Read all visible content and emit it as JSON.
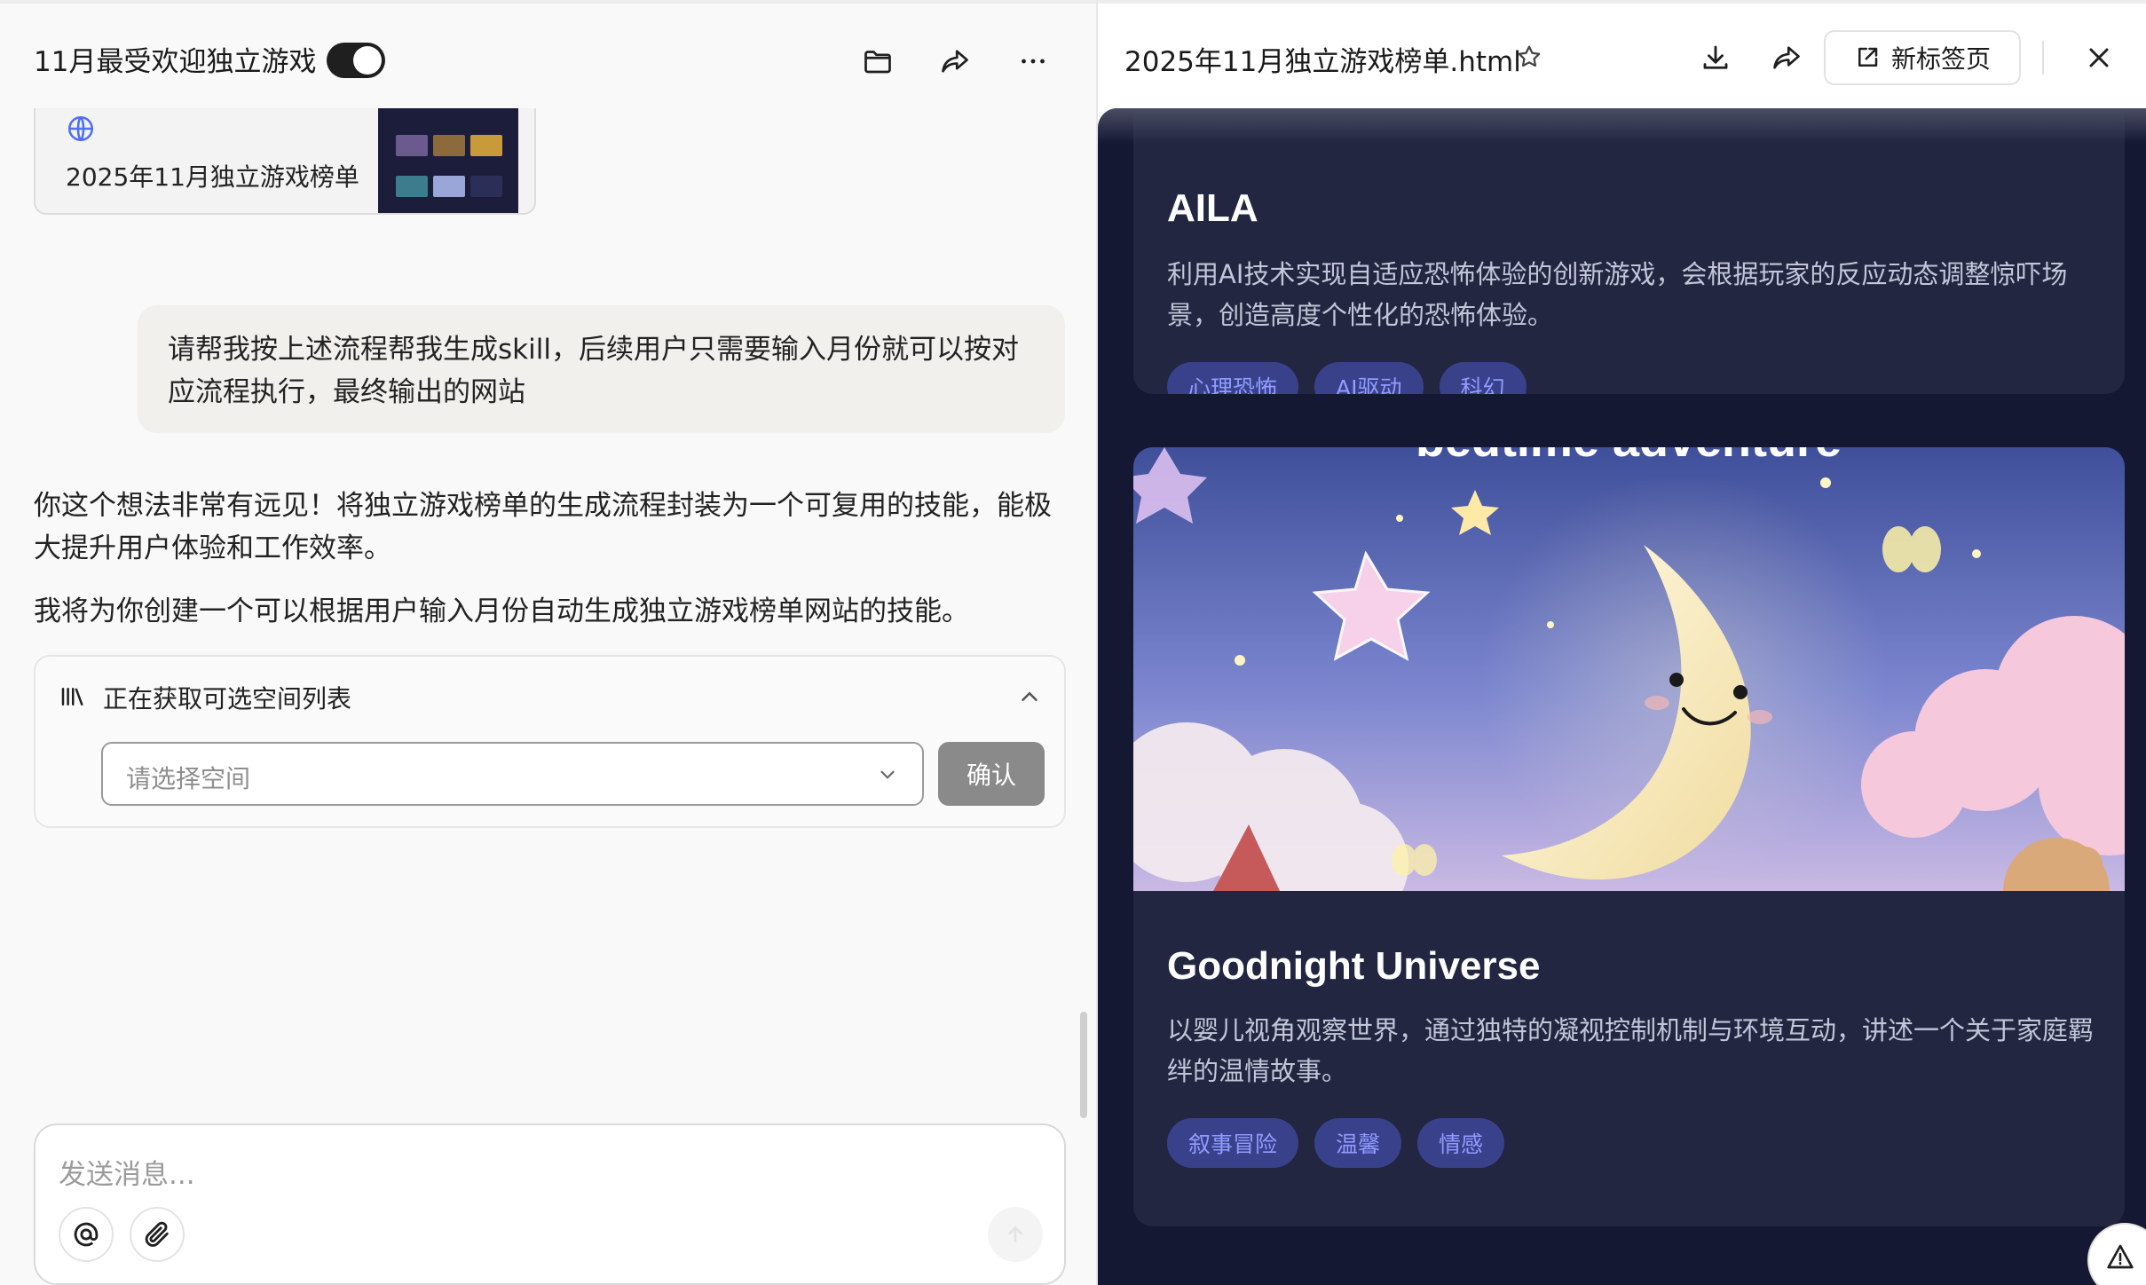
{
  "chat": {
    "title": "11月最受欢迎独立游戏",
    "card_title": "2025年11月独立游戏榜单",
    "user_message": "请帮我按上述流程帮我生成skill，后续用户只需要输入月份就可以按对应流程执行，最终输出的网站",
    "ai_message_1": "你这个想法非常有远见！将独立游戏榜单的生成流程封装为一个可复用的技能，能极大提升用户体验和工作效率。",
    "ai_message_2": "我将为你创建一个可以根据用户输入月份自动生成独立游戏榜单网站的技能。",
    "tool": {
      "label": "正在获取可选空间列表",
      "select_placeholder": "请选择空间",
      "confirm_label": "确认"
    },
    "composer_placeholder": "发送消息..."
  },
  "preview": {
    "file_title": "2025年11月独立游戏榜单.html",
    "new_tab_label": "新标签页",
    "games": [
      {
        "name": "AILA",
        "description": "利用AI技术实现自适应恐怖体验的创新游戏，会根据玩家的反应动态调整惊吓场景，创造高度个性化的恐怖体验。",
        "tags": [
          "心理恐怖",
          "AI驱动",
          "科幻"
        ]
      },
      {
        "name": "Goodnight Universe",
        "image_caption": "bedtime adventure",
        "description": "以婴儿视角观察世界，通过独特的凝视控制机制与环境互动，讲述一个关于家庭羁绊的温情故事。",
        "tags": [
          "叙事冒险",
          "温馨",
          "情感"
        ]
      }
    ]
  },
  "icons": {
    "header": [
      "folder-icon",
      "share-icon",
      "more-icon"
    ],
    "preview": [
      "star-icon",
      "download-icon",
      "share-icon",
      "external-link-icon",
      "close-icon"
    ],
    "composer": [
      "at-icon",
      "paperclip-icon",
      "send-arrow-icon"
    ],
    "tool": [
      "library-icon",
      "chevron-up-icon",
      "chevron-down-icon"
    ]
  },
  "colors": {
    "preview_bg": "#141833",
    "card_bg": "#222641",
    "tag_bg": "#3a418b",
    "tag_text": "#8f9cff",
    "accent_link": "#4f6ef7"
  }
}
